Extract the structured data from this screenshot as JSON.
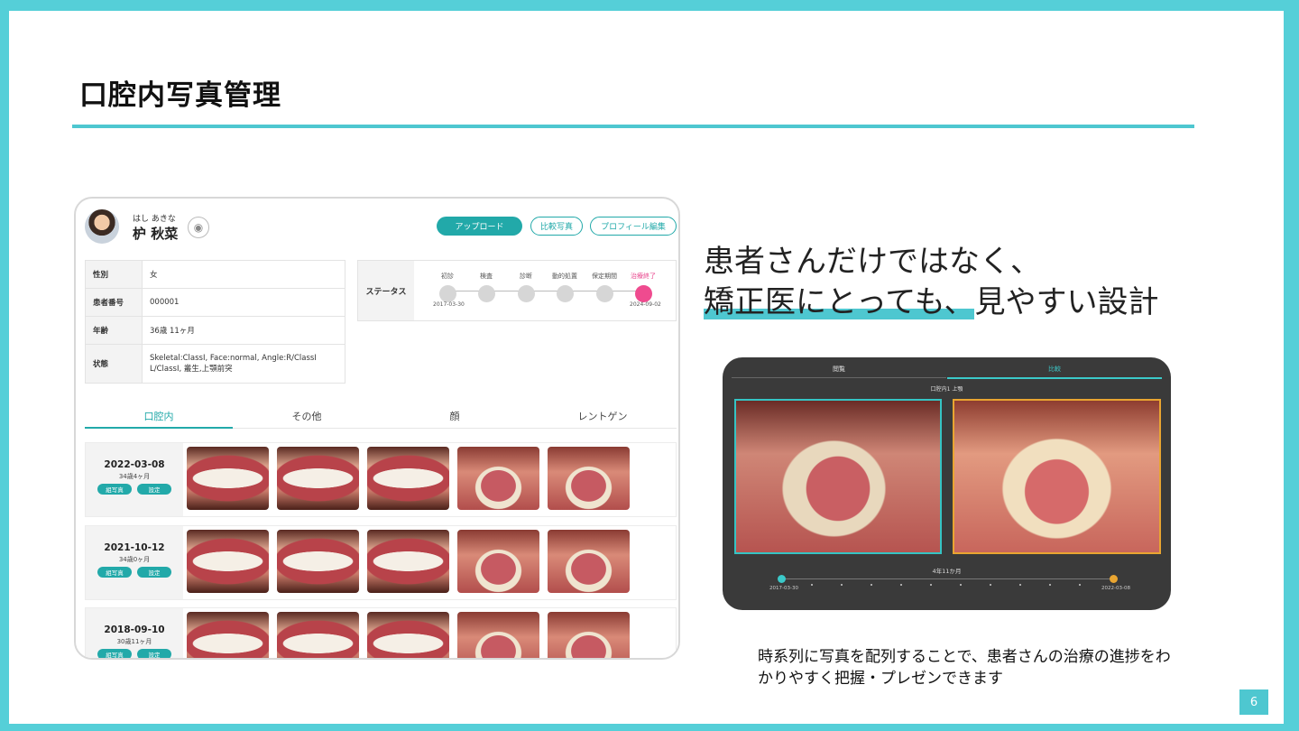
{
  "slide": {
    "title": "口腔内写真管理",
    "page_number": "6"
  },
  "app": {
    "patient": {
      "kana": "はし あきな",
      "name": "枦 秋菜"
    },
    "buttons": {
      "upload": "アップロード",
      "compare": "比較写真",
      "profile_edit": "プロフィール編集"
    },
    "info": [
      {
        "key": "性別",
        "value": "女"
      },
      {
        "key": "患者番号",
        "value": "000001"
      },
      {
        "key": "年齢",
        "value": "36歳 11ヶ月"
      },
      {
        "key": "状態",
        "value": "Skeletal:ClassI, Face:normal, Angle:R/ClassI L/ClassI, 叢生,上顎前突"
      }
    ],
    "status": {
      "label": "ステータス",
      "steps": [
        "初診",
        "検査",
        "診断",
        "動的処置",
        "保定期間",
        "治療終了"
      ],
      "start_date": "2017-03-30",
      "end_date": "2024-09-02"
    },
    "tabs": [
      "口腔内",
      "その他",
      "顔",
      "レントゲン"
    ],
    "rows": [
      {
        "date": "2022-03-08",
        "age": "34歳4ヶ月",
        "btn1": "組写真",
        "btn2": "設定"
      },
      {
        "date": "2021-10-12",
        "age": "34歳0ヶ月",
        "btn1": "組写真",
        "btn2": "設定"
      },
      {
        "date": "2018-09-10",
        "age": "30歳11ヶ月",
        "btn1": "組写真",
        "btn2": "設定"
      }
    ]
  },
  "headline": {
    "line1": "患者さんだけではなく、",
    "line2": "矯正医にとっても、見やすい設計"
  },
  "compare_view": {
    "tabs": [
      "閲覧",
      "比較"
    ],
    "subtitle": "口腔内1 上顎",
    "span": "4年11か月",
    "start_date": "2017-03-30",
    "end_date": "2022-03-08"
  },
  "caption": "時系列に写真を配列することで、患者さんの治療の進捗をわかりやすく把握・プレゼンできます",
  "colors": {
    "accent": "#4ec7d0",
    "teal_button": "#22a9a9",
    "pink_status": "#ef4b8f",
    "orange_frame": "#e9a531"
  }
}
